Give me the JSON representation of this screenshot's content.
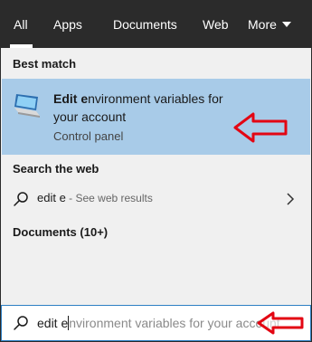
{
  "tabs": [
    {
      "label": "All"
    },
    {
      "label": "Apps"
    },
    {
      "label": "Documents"
    },
    {
      "label": "Web"
    },
    {
      "label": "More"
    }
  ],
  "best_match": {
    "heading": "Best match",
    "title_bold": "Edit e",
    "title_rest": "nvironment variables for your account",
    "subtitle": "Control panel"
  },
  "web": {
    "heading": "Search the web",
    "query": "edit e",
    "hint": " - See web results"
  },
  "documents": {
    "heading": "Documents (10+)"
  },
  "searchbox": {
    "typed": "edit e",
    "suggestion": "nvironment variables for your account"
  },
  "colors": {
    "tab_bar": "#2b2b2b",
    "highlight": "#a8cbe8",
    "annotation_arrow": "#e30613"
  },
  "icons": [
    "pc-monitor-icon",
    "search-icon",
    "chevron-right-icon",
    "chevron-down-icon"
  ]
}
